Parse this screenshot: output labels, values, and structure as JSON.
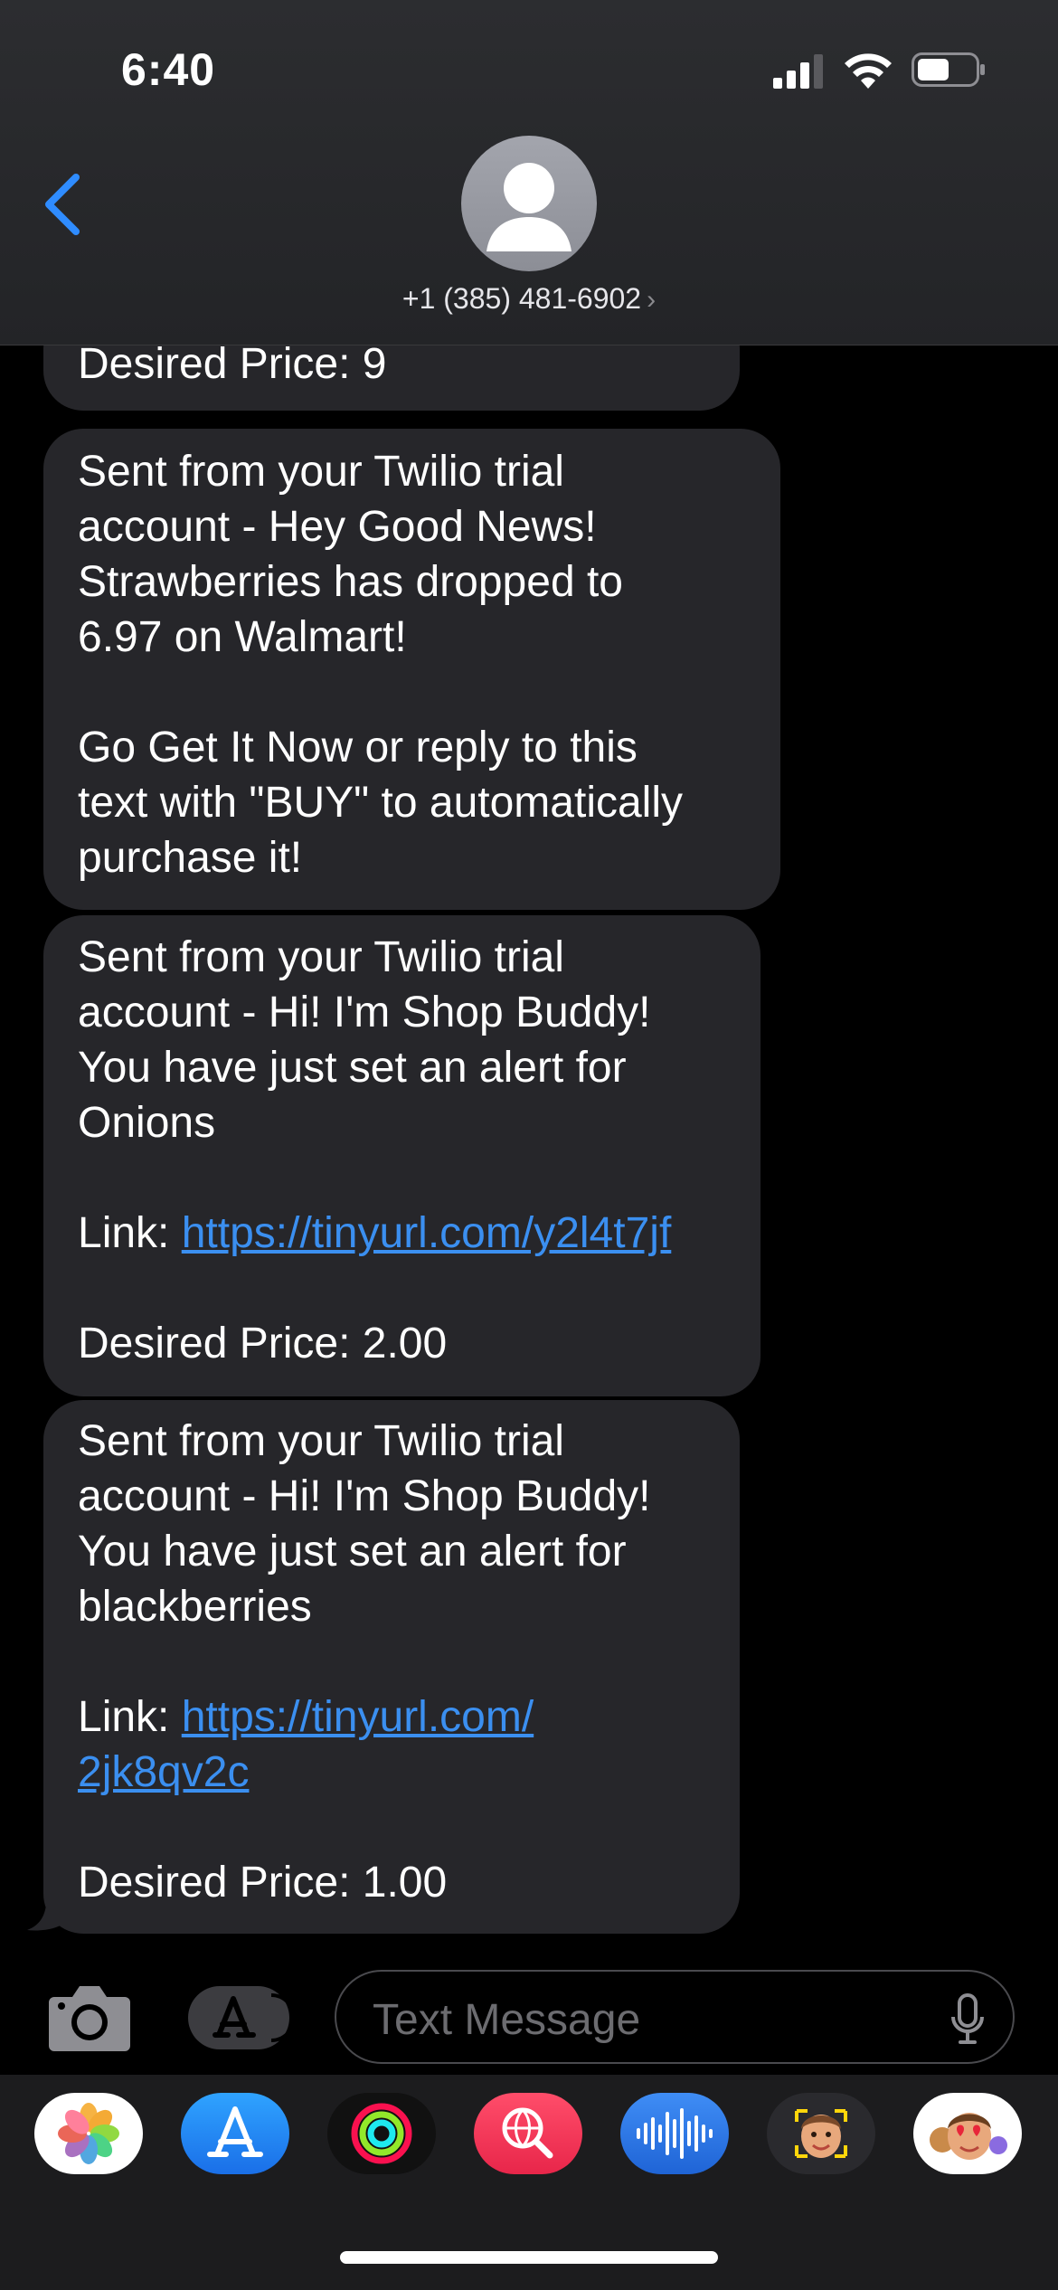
{
  "status": {
    "time": "6:40"
  },
  "contact": {
    "phone": "+1 (385) 481-6902",
    "chevron": "›"
  },
  "messages": {
    "m0": {
      "line1": "Desired Price: 9"
    },
    "m1": {
      "l1": "Sent from your Twilio trial",
      "l2": "account - Hey Good News!",
      "l3": "Strawberries has dropped to",
      "l4": "6.97 on Walmart!",
      "l5": "Go Get It Now or reply to this",
      "l6": "text with \"BUY\" to automatically",
      "l7": "purchase it!"
    },
    "m2": {
      "l1": "Sent from your Twilio trial",
      "l2": "account - Hi! I'm Shop Buddy!",
      "l3": "You have just set an alert for",
      "l4": "Onions",
      "link_prefix": "Link: ",
      "link": "https://tinyurl.com/y2l4t7jf",
      "price": "Desired Price: 2.00"
    },
    "m3": {
      "l1": "Sent from your Twilio trial",
      "l2": "account - Hi! I'm Shop Buddy!",
      "l3": "You have just set an alert for",
      "l4": "blackberries",
      "link_prefix": "Link: ",
      "link_a": "https://tinyurl.com/",
      "link_b": "2jk8qv2c",
      "price": "Desired Price: 1.00"
    }
  },
  "compose": {
    "placeholder": "Text Message"
  },
  "drawer_apps": [
    {
      "name": "photos-app-icon"
    },
    {
      "name": "app-store-icon"
    },
    {
      "name": "fitness-activity-icon"
    },
    {
      "name": "web-search-icon"
    },
    {
      "name": "audio-message-icon"
    },
    {
      "name": "memoji-icon"
    },
    {
      "name": "memoji-stickers-icon"
    }
  ],
  "colors": {
    "accent": "#3b8ff0",
    "bubble": "#26262a",
    "background": "#000000"
  }
}
